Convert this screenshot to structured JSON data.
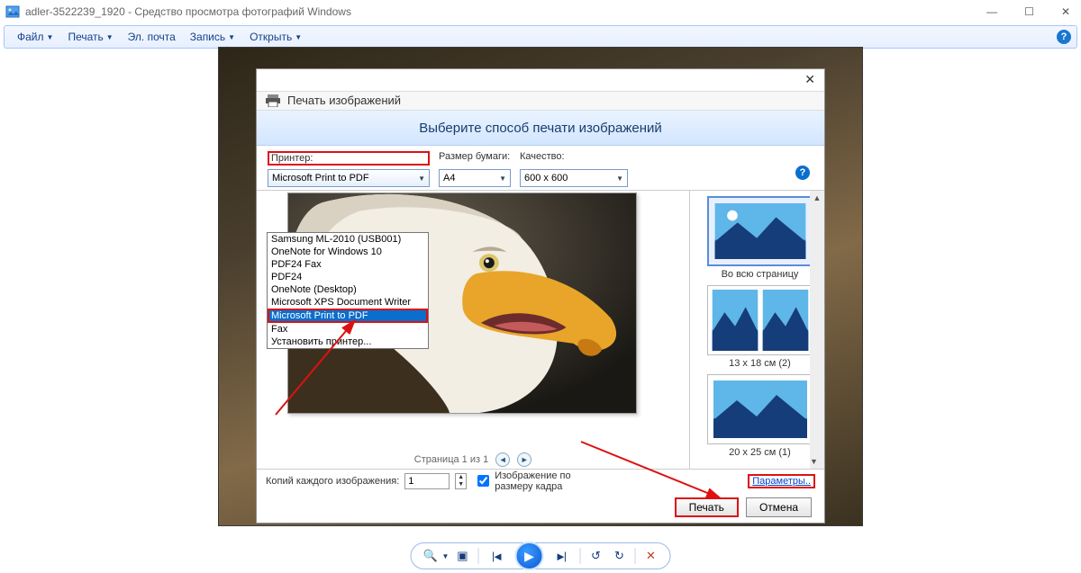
{
  "titlebar": {
    "app_icon": "image-viewer-icon",
    "title": "adler-3522239_1920 - Средство просмотра фотографий Windows"
  },
  "menubar": {
    "items": [
      {
        "label": "Файл",
        "has_caret": true
      },
      {
        "label": "Печать",
        "has_caret": true
      },
      {
        "label": "Эл. почта",
        "has_caret": false
      },
      {
        "label": "Запись",
        "has_caret": true
      },
      {
        "label": "Открыть",
        "has_caret": true
      }
    ]
  },
  "dialog": {
    "title": "Печать изображений",
    "banner": "Выберите способ печати изображений",
    "options": {
      "printer_label": "Принтер:",
      "paper_label": "Размер бумаги:",
      "quality_label": "Качество:",
      "printer_value": "Microsoft Print to PDF",
      "paper_value": "A4",
      "quality_value": "600 x 600"
    },
    "printer_list": [
      "Samsung ML-2010 (USB001)",
      "OneNote for Windows 10",
      "PDF24 Fax",
      "PDF24",
      "OneNote (Desktop)",
      "Microsoft XPS Document Writer",
      "Microsoft Print to PDF",
      "Fax",
      "Установить принтер..."
    ],
    "printer_selected_index": 6,
    "page_nav": "Страница 1 из 1",
    "thumbs": [
      {
        "label": "Во всю страницу",
        "layout": "single",
        "selected": true
      },
      {
        "label": "13 x 18 см (2)",
        "layout": "double",
        "selected": false
      },
      {
        "label": "20 x 25 см (1)",
        "layout": "single",
        "selected": false
      }
    ],
    "footer": {
      "copies_label": "Копий каждого изображения:",
      "copies_value": "1",
      "fit_label": "Изображение по размеру кадра",
      "options_link": "Параметры..",
      "print_btn": "Печать",
      "cancel_btn": "Отмена"
    }
  }
}
